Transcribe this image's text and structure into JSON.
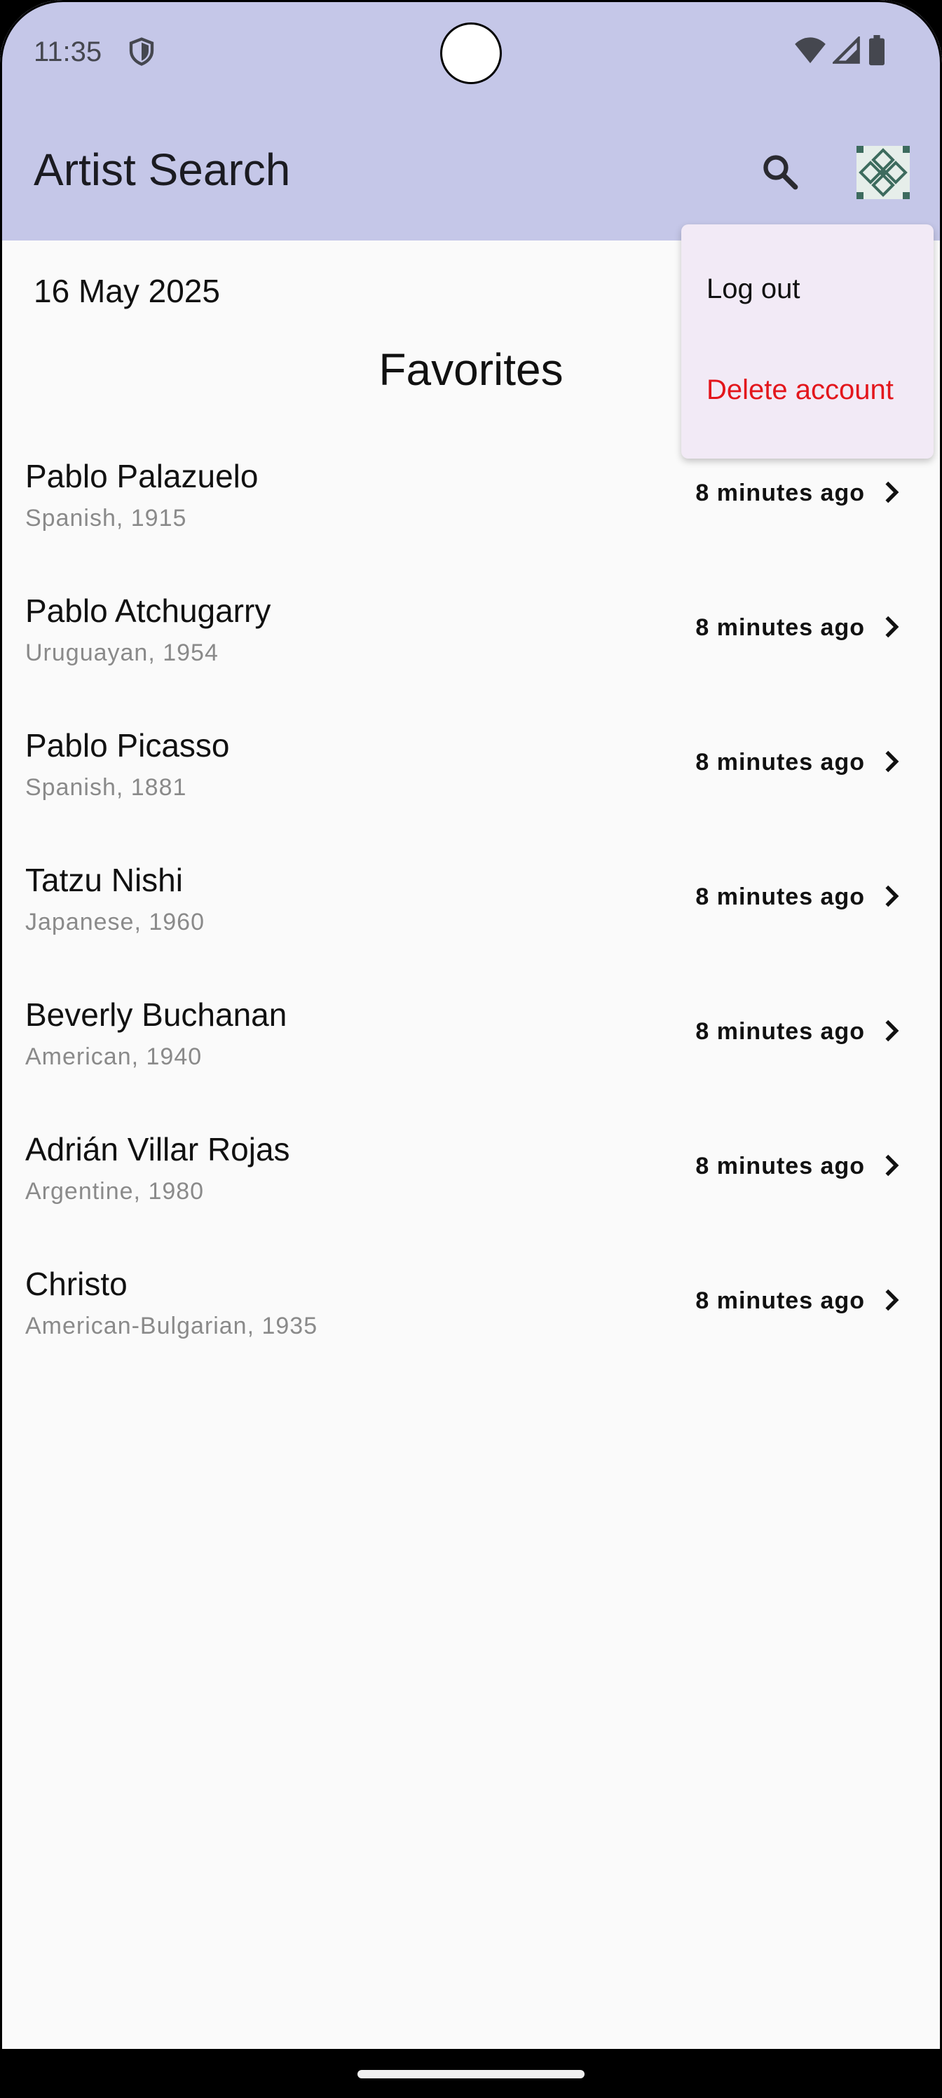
{
  "status_bar": {
    "time": "11:35",
    "icons": [
      "shield-icon",
      "wifi-icon",
      "signal-icon",
      "battery-icon"
    ]
  },
  "app_bar": {
    "title": "Artist Search",
    "search_icon": "search-icon",
    "avatar_icon": "patterned-avatar-icon"
  },
  "date": "16 May 2025",
  "section_title": "Favorites",
  "favorites": [
    {
      "name": "Pablo Palazuelo",
      "subtitle": "Spanish, 1915",
      "time": "8 minutes ago"
    },
    {
      "name": "Pablo Atchugarry",
      "subtitle": "Uruguayan, 1954",
      "time": "8 minutes ago"
    },
    {
      "name": "Pablo Picasso",
      "subtitle": "Spanish, 1881",
      "time": "8 minutes ago"
    },
    {
      "name": "Tatzu Nishi",
      "subtitle": "Japanese, 1960",
      "time": "8 minutes ago"
    },
    {
      "name": "Beverly Buchanan",
      "subtitle": "American, 1940",
      "time": "8 minutes ago"
    },
    {
      "name": "Adrián Villar Rojas",
      "subtitle": "Argentine, 1980",
      "time": "8 minutes ago"
    },
    {
      "name": "Christo",
      "subtitle": "American-Bulgarian, 1935",
      "time": "8 minutes ago"
    }
  ],
  "menu": {
    "logout": "Log out",
    "delete_account": "Delete account"
  },
  "colors": {
    "app_bar": "#c5c7e8",
    "menu_bg": "#f2eaf6",
    "danger": "#e3161c",
    "background": "#fafafa"
  }
}
